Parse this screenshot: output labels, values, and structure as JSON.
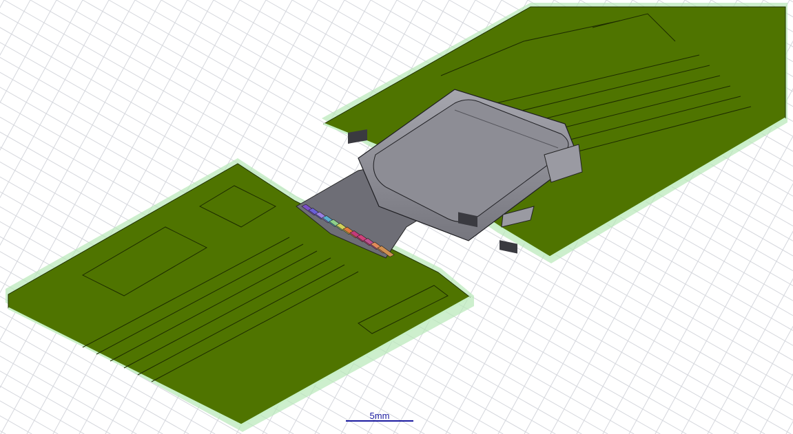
{
  "viewport": {
    "scale_bar_label": "5mm"
  },
  "colors": {
    "background": "#ffffff",
    "grid": "#d4d6dc",
    "pcb_green": "#4f7400",
    "pcb_edge": "#b8e8b8",
    "connector_shell": "#8c8c94",
    "scale_bar": "#1a1aa0"
  },
  "objects": [
    {
      "name": "left-pcb-board",
      "label": ""
    },
    {
      "name": "right-pcb-board",
      "label": ""
    },
    {
      "name": "usb-c-connector",
      "label": ""
    }
  ],
  "pin_colors": [
    "#7b4fc9",
    "#6b5fd8",
    "#9a7fe0",
    "#5ab0d0",
    "#8fd08a",
    "#d0d05a",
    "#e07a3a",
    "#c43a7a",
    "#d0407a",
    "#c05090",
    "#e08a5a",
    "#d09050"
  ]
}
